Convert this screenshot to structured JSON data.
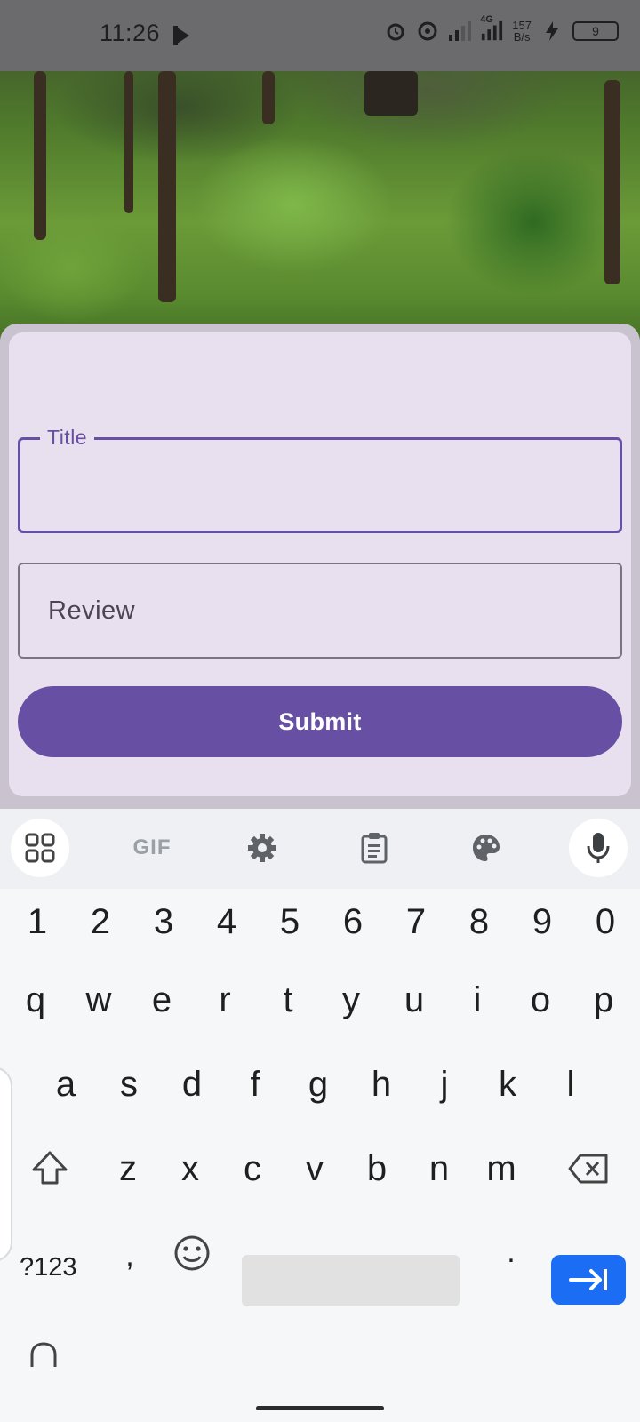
{
  "status_bar": {
    "time": "11:26",
    "network_speed_value": "157",
    "network_speed_unit": "B/s",
    "network_type": "4G",
    "battery_level": "9"
  },
  "form": {
    "title_label": "Title",
    "title_value": "",
    "review_placeholder": "Review",
    "submit_label": "Submit"
  },
  "keyboard": {
    "toolbar": {
      "gif_label": "GIF"
    },
    "number_row": [
      "1",
      "2",
      "3",
      "4",
      "5",
      "6",
      "7",
      "8",
      "9",
      "0"
    ],
    "row1": [
      "q",
      "w",
      "e",
      "r",
      "t",
      "y",
      "u",
      "i",
      "o",
      "p"
    ],
    "row2": [
      "a",
      "s",
      "d",
      "f",
      "g",
      "h",
      "j",
      "k",
      "l"
    ],
    "row3": [
      "z",
      "x",
      "c",
      "v",
      "b",
      "n",
      "m"
    ],
    "symbols_label": "?123",
    "comma": ",",
    "period": "."
  },
  "colors": {
    "accent": "#6750a4",
    "card_bg": "#e8e0ee",
    "enter_key": "#1b6ef3"
  }
}
